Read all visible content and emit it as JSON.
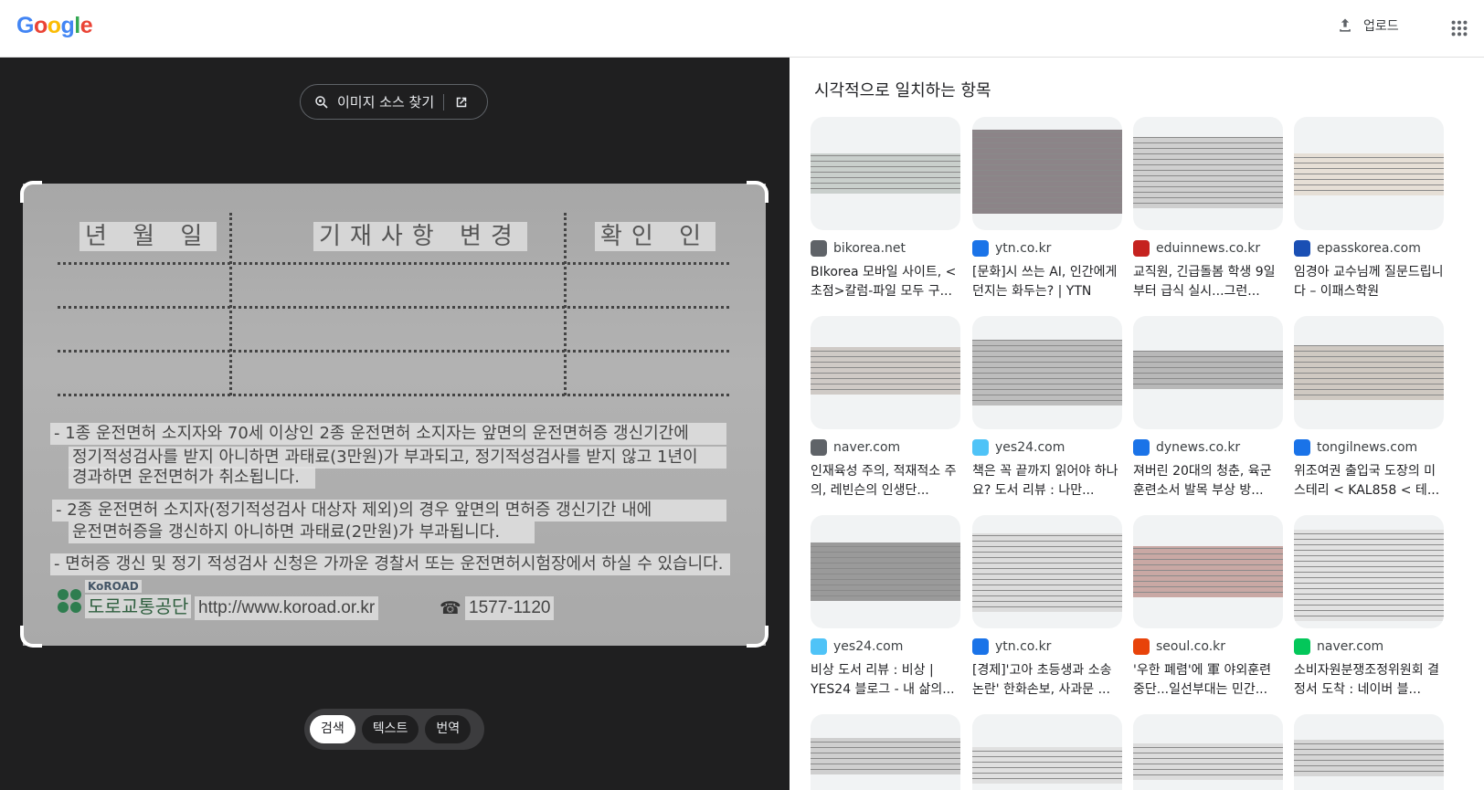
{
  "header": {
    "logo": "Google",
    "upload_label": "업로드"
  },
  "left": {
    "find_source_label": "이미지 소스 찾기",
    "photo": {
      "headers": [
        "년 월 일",
        "기재사항 변경",
        "확인 인"
      ],
      "lines": [
        "- 1종 운전면허 소지자와 70세 이상인 2종 운전면허 소지자는 앞면의 운전면허증 갱신기간에",
        "정기적성검사를 받지 아니하면 과태료(3만원)가 부과되고, 정기적성검사를 받지 않고 1년이",
        "경과하면 운전면허가 취소됩니다.",
        "- 2종 운전면허 소지자(정기적성검사 대상자 제외)의 경우 앞면의 면허증 갱신기간 내에",
        "운전면허증을 갱신하지 아니하면 과태료(2만원)가 부과됩니다.",
        "- 면허증 갱신 및 정기 적성검사 신청은 가까운 경찰서 또는 운전면허시험장에서 하실 수 있습니다."
      ],
      "org_small": "KoROAD",
      "org_name": "도로교통공단",
      "url": "http://www.koroad.or.kr",
      "phone_icon": "☎",
      "phone": "1577-1120"
    },
    "modes": [
      "검색",
      "텍스트",
      "번역"
    ]
  },
  "right": {
    "section_title": "시각적으로 일치하는 항목",
    "results": [
      {
        "source": "bikorea.net",
        "title": "BIkorea 모바일 사이트, < 초점>칼럼-파일 모두 구...",
        "fav_color": "#5f6368"
      },
      {
        "source": "ytn.co.kr",
        "title": "[문화]시 쓰는 AI, 인간에게 던지는 화두는? | YTN",
        "fav_color": "#1a73e8"
      },
      {
        "source": "eduinnews.co.kr",
        "title": "교직원, 긴급돌봄 학생 9일부터 급식 실시...그런...",
        "fav_color": "#c5221f"
      },
      {
        "source": "epasskorea.com",
        "title": "임경아 교수님께 질문드립니다 – 이패스학원",
        "fav_color": "#1a4fb4"
      },
      {
        "source": "naver.com",
        "title": "인재육성 주의, 적재적소 주의, 레빈슨의 인생단...",
        "fav_color": "#5f6368"
      },
      {
        "source": "yes24.com",
        "title": "책은 꼭 끝까지 읽어야 하나요? 도서 리뷰 : 나만...",
        "fav_color": "#4fc3f7"
      },
      {
        "source": "dynews.co.kr",
        "title": "져버린 20대의 청춘, 육군 훈련소서 발목 부상 방...",
        "fav_color": "#1a73e8"
      },
      {
        "source": "tongilnews.com",
        "title": "위조여권 출입국 도장의 미스테리 < KAL858 < 테...",
        "fav_color": "#1a73e8"
      },
      {
        "source": "yes24.com",
        "title": "비상 도서 리뷰 : 비상 | YES24 블로그 - 내 삶의...",
        "fav_color": "#4fc3f7"
      },
      {
        "source": "ytn.co.kr",
        "title": "[경제]'고아 초등생과 소송 논란' 한화손보, 사과문 ...",
        "fav_color": "#1a73e8"
      },
      {
        "source": "seoul.co.kr",
        "title": "'우한 폐렴'에 軍 야외훈련 중단...일선부대는 민간...",
        "fav_color": "#e8430a"
      },
      {
        "source": "naver.com",
        "title": "소비자원분쟁조정위원회 결정서 도착 : 네이버 블...",
        "fav_color": "#03c75a"
      },
      {
        "source": "",
        "title": "",
        "fav_color": "#ffffff"
      },
      {
        "source": "",
        "title": "",
        "fav_color": "#ffffff"
      },
      {
        "source": "",
        "title": "",
        "fav_color": "#ffffff"
      },
      {
        "source": "",
        "title": "",
        "fav_color": "#ffffff"
      }
    ]
  },
  "colors": {
    "left_bg": "#1f1f20",
    "accent_blue": "#4285f4",
    "accent_red": "#ea4335",
    "accent_yellow": "#fbbc05",
    "accent_green": "#34a853"
  }
}
